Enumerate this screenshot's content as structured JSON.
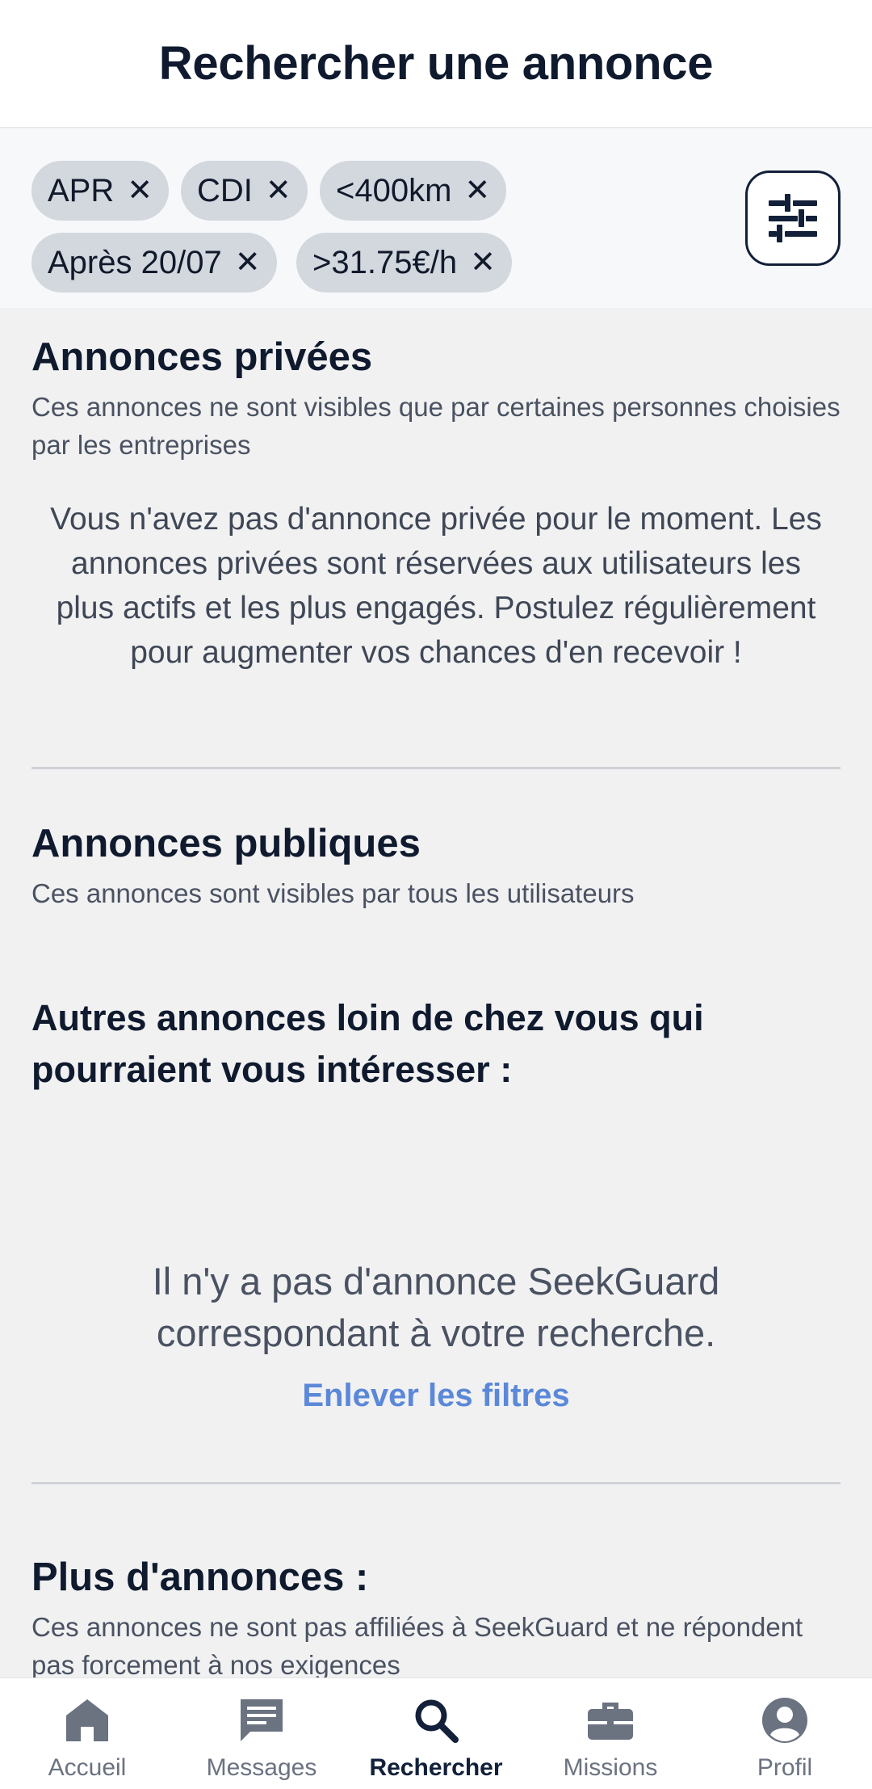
{
  "header": {
    "title": "Rechercher une annonce"
  },
  "filters": {
    "chips": [
      {
        "label": "APR",
        "remove": "✕"
      },
      {
        "label": "CDI",
        "remove": "✕"
      },
      {
        "label": "<400km",
        "remove": "✕"
      },
      {
        "label": "Après 20/07",
        "remove": "✕"
      },
      {
        "label": ">31.75€/h",
        "remove": "✕"
      }
    ],
    "filter_button_icon": "sliders-icon"
  },
  "private_section": {
    "title": "Annonces privées",
    "subtitle": "Ces annonces ne sont visibles que par certaines personnes choisies par les entreprises",
    "empty_message": "Vous n'avez pas d'annonce privée pour le moment. Les annonces privées sont réservées aux utilisateurs les plus actifs et les plus engagés. Postulez régulièrement pour augmenter vos chances d'en recevoir !"
  },
  "public_section": {
    "title": "Annonces publiques",
    "subtitle": "Ces annonces sont visibles par tous les utilisateurs"
  },
  "far_section": {
    "title": "Autres annonces loin de chez vous qui pourraient vous intéresser :"
  },
  "empty_result": {
    "message": "Il n'y a pas d'annonce SeekGuard correspondant à votre recherche.",
    "remove_filters_link": "Enlever les filtres"
  },
  "more_section": {
    "title": "Plus d'annonces :",
    "subtitle": "Ces annonces ne sont pas affiliées à SeekGuard et ne répondent pas forcement à nos exigences"
  },
  "tabbar": {
    "items": [
      {
        "label": "Accueil",
        "icon": "home-icon",
        "active": false
      },
      {
        "label": "Messages",
        "icon": "message-icon",
        "active": false
      },
      {
        "label": "Rechercher",
        "icon": "search-icon",
        "active": true
      },
      {
        "label": "Missions",
        "icon": "briefcase-icon",
        "active": false
      },
      {
        "label": "Profil",
        "icon": "profile-icon",
        "active": false
      }
    ]
  },
  "colors": {
    "primary": "#12203a",
    "link": "#5b88d8",
    "chip_bg": "#d3d7de",
    "page_bg": "#f1f1f2",
    "inactive_tab": "#6b7280"
  }
}
